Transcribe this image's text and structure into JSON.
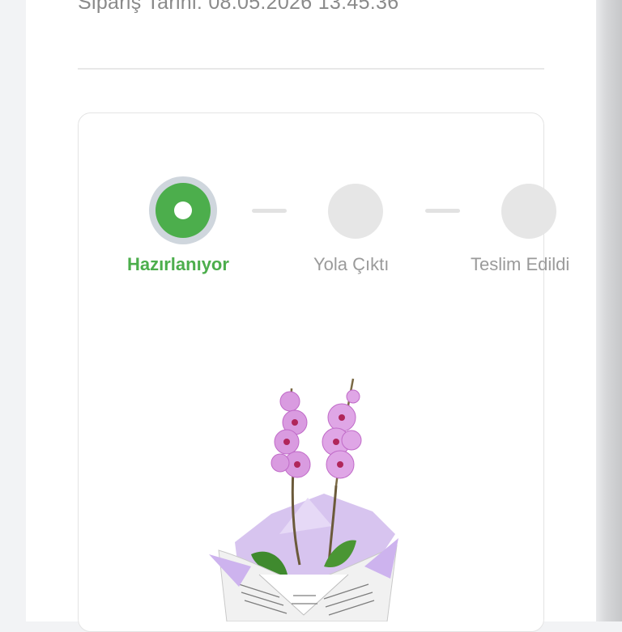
{
  "order": {
    "date_text": "Sipariş Tarihi: 08.05.2026 13:45:36"
  },
  "tracking": {
    "steps": [
      {
        "label": "Hazırlanıyor",
        "state": "active"
      },
      {
        "label": "Yola Çıktı",
        "state": "pending"
      },
      {
        "label": "Teslim Edildi",
        "state": "pending"
      }
    ]
  },
  "colors": {
    "active": "#4cae4c",
    "inactive": "#e6e6e6",
    "text_muted": "#9a9a9a"
  },
  "product": {
    "image_icon": "orchid-pot-image"
  }
}
